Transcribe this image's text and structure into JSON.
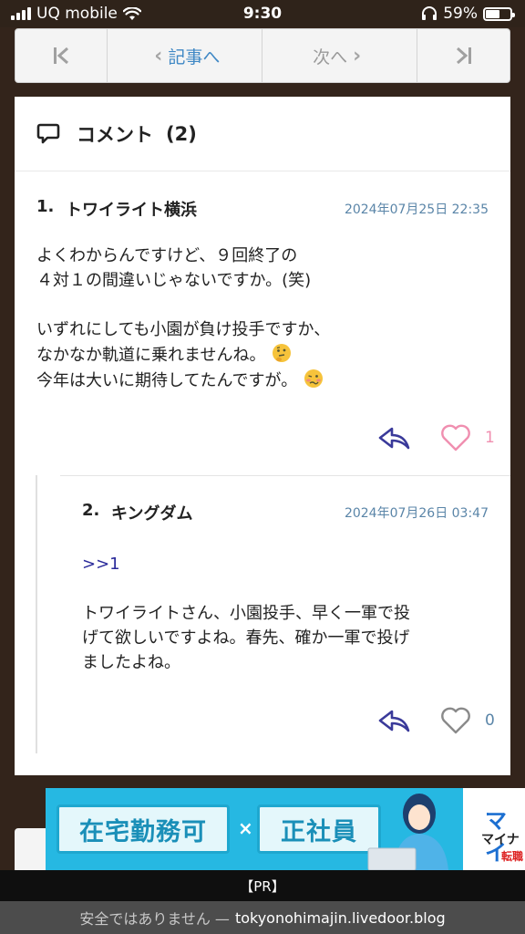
{
  "status_bar": {
    "carrier": "UQ mobile",
    "time": "9:30",
    "battery_text": "59%",
    "battery_level": 0.59
  },
  "pager": {
    "prev_label": "記事へ",
    "next_label": "次へ",
    "first_icon": "skip-first-icon",
    "last_icon": "skip-last-icon"
  },
  "comments_section": {
    "title": "コメント",
    "count": "(2)",
    "items": [
      {
        "number": "1.",
        "name": "トワイライト横浜",
        "date": "2024年07月25日 22:35",
        "lines": [
          "よくわからんですけど、９回終了の",
          "４対１の間違いじゃないですか。(笑)",
          "",
          "いずれにしても小園が負け投手ですか、",
          "なかなか軌道に乗れませんね。",
          "今年は大いに期待してたんですが。"
        ],
        "emojis": [
          "thinking-face-icon",
          "woozy-face-icon"
        ],
        "likes": "1",
        "liked_color": "#f08fb0"
      },
      {
        "number": "2.",
        "name": "キングダム",
        "date": "2024年07月26日 03:47",
        "anchor": ">>1",
        "lines": [
          "トワイライトさん、小園投手、早く一軍で投",
          "げて欲しいですよね。春先、確か一軍で投げ",
          "ましたよね。"
        ],
        "likes": "0",
        "count_color": "#5a85a8"
      }
    ]
  },
  "ad": {
    "chip1": "在宅勤務可",
    "separator": "×",
    "chip2": "正社員",
    "brand": "マイ",
    "brand_sub1": "マイナ",
    "brand_sub2": "転職"
  },
  "pr_label": "【PR】",
  "url_bar": {
    "security_text": "安全ではありません —",
    "domain": "tokyonohimajin.livedoor.blog"
  },
  "colors": {
    "page_bg": "#33241b",
    "accent_link": "#3f88c5",
    "reply_icon": "#3a3a9a",
    "ad_blue": "#26b8e2"
  }
}
